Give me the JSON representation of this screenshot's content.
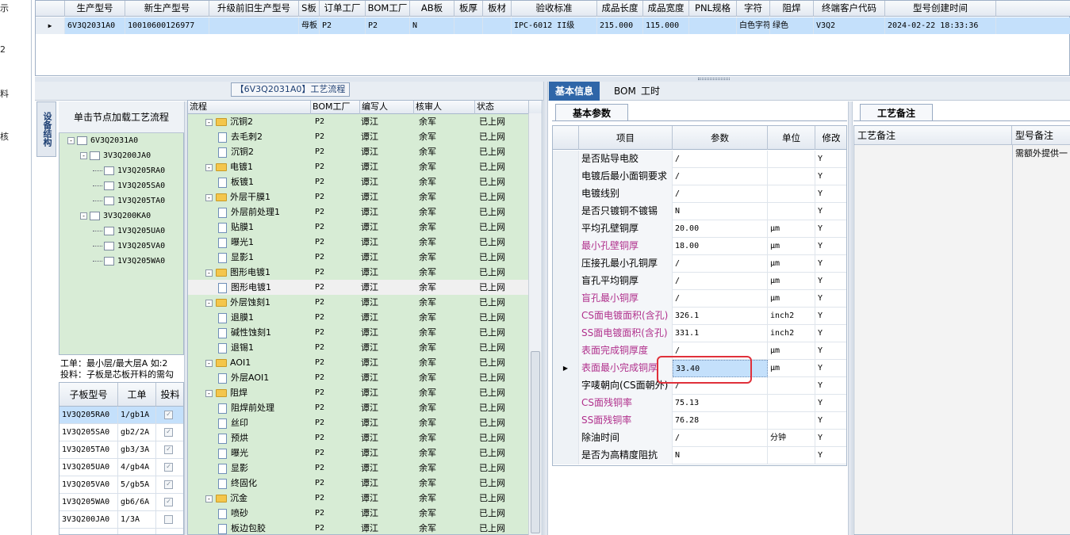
{
  "left_nav": [
    "示",
    "2",
    "料",
    "核"
  ],
  "top_grid": {
    "columns": [
      "生产型号",
      "新生产型号",
      "升级前旧生产型号",
      "S板",
      "订单工厂",
      "BOM工厂",
      "AB板",
      "板厚",
      "板材",
      "验收标准",
      "成品长度",
      "成品宽度",
      "PNL规格",
      "字符",
      "阻焊",
      "终端客户代码",
      "型号创建时间"
    ],
    "row": [
      "6V3Q2031A0",
      "10010600126977",
      "",
      "母板",
      "P2",
      "P2",
      "N",
      "",
      "",
      "IPC-6012 II级",
      "215.000",
      "115.000",
      "",
      "白色字符",
      "绿色",
      "V3Q2",
      "2024-02-22 18:33:36"
    ]
  },
  "lower_title": "【6V3Q2031A0】工艺流程",
  "vtab_label": "设备结构",
  "load_button": "单击节点加载工艺流程",
  "tree": [
    {
      "label": "6V3Q2031A0",
      "level": 0,
      "exp": "-"
    },
    {
      "label": "3V3Q200JA0",
      "level": 1,
      "exp": "-"
    },
    {
      "label": "1V3Q205RA0",
      "level": 2,
      "exp": ""
    },
    {
      "label": "1V3Q205SA0",
      "level": 2,
      "exp": ""
    },
    {
      "label": "1V3Q205TA0",
      "level": 2,
      "exp": ""
    },
    {
      "label": "3V3Q200KA0",
      "level": 1,
      "exp": "-"
    },
    {
      "label": "1V3Q205UA0",
      "level": 2,
      "exp": ""
    },
    {
      "label": "1V3Q205VA0",
      "level": 2,
      "exp": ""
    },
    {
      "label": "1V3Q205WA0",
      "level": 2,
      "exp": ""
    }
  ],
  "info_lines": [
    "工单：最小层/最大层A 如:2",
    "投料：子板是芯板开料的需勾"
  ],
  "sub_grid": {
    "columns": [
      "子板型号",
      "工单",
      "投料"
    ],
    "rows": [
      [
        "1V3Q205RA0",
        "1/gb1A",
        "✓"
      ],
      [
        "1V3Q205SA0",
        "gb2/2A",
        "✓"
      ],
      [
        "1V3Q205TA0",
        "gb3/3A",
        "✓"
      ],
      [
        "1V3Q205UA0",
        "4/gb4A",
        "✓"
      ],
      [
        "1V3Q205VA0",
        "5/gb5A",
        "✓"
      ],
      [
        "1V3Q205WA0",
        "gb6/6A",
        "✓"
      ],
      [
        "3V3Q200JA0",
        "1/3A",
        ""
      ],
      [
        "",
        "",
        ""
      ]
    ]
  },
  "process_grid": {
    "columns": [
      "流程",
      "BOM工厂",
      "编写人",
      "核审人",
      "状态"
    ],
    "rows": [
      {
        "name": "沉铜2",
        "type": "folder",
        "bom": "P2",
        "writer": "谭江",
        "reviewer": "余军",
        "status": "已上网"
      },
      {
        "name": "去毛刺2",
        "type": "doc",
        "bom": "P2",
        "writer": "谭江",
        "reviewer": "余军",
        "status": "已上网"
      },
      {
        "name": "沉铜2",
        "type": "doc",
        "bom": "P2",
        "writer": "谭江",
        "reviewer": "余军",
        "status": "已上网"
      },
      {
        "name": "电镀1",
        "type": "folder",
        "bom": "P2",
        "writer": "谭江",
        "reviewer": "余军",
        "status": "已上网"
      },
      {
        "name": "板镀1",
        "type": "doc",
        "bom": "P2",
        "writer": "谭江",
        "reviewer": "余军",
        "status": "已上网"
      },
      {
        "name": "外层干膜1",
        "type": "folder",
        "bom": "P2",
        "writer": "谭江",
        "reviewer": "余军",
        "status": "已上网"
      },
      {
        "name": "外层前处理1",
        "type": "doc",
        "bom": "P2",
        "writer": "谭江",
        "reviewer": "余军",
        "status": "已上网"
      },
      {
        "name": "贴膜1",
        "type": "doc",
        "bom": "P2",
        "writer": "谭江",
        "reviewer": "余军",
        "status": "已上网"
      },
      {
        "name": "曝光1",
        "type": "doc",
        "bom": "P2",
        "writer": "谭江",
        "reviewer": "余军",
        "status": "已上网"
      },
      {
        "name": "显影1",
        "type": "doc",
        "bom": "P2",
        "writer": "谭江",
        "reviewer": "余军",
        "status": "已上网"
      },
      {
        "name": "图形电镀1",
        "type": "folder",
        "bom": "P2",
        "writer": "谭江",
        "reviewer": "余军",
        "status": "已上网"
      },
      {
        "name": "图形电镀1",
        "type": "doc",
        "bom": "P2",
        "writer": "谭江",
        "reviewer": "余军",
        "status": "已上网",
        "selected": true
      },
      {
        "name": "外层蚀刻1",
        "type": "folder",
        "bom": "P2",
        "writer": "谭江",
        "reviewer": "余军",
        "status": "已上网"
      },
      {
        "name": "退膜1",
        "type": "doc",
        "bom": "P2",
        "writer": "谭江",
        "reviewer": "余军",
        "status": "已上网"
      },
      {
        "name": "碱性蚀刻1",
        "type": "doc",
        "bom": "P2",
        "writer": "谭江",
        "reviewer": "余军",
        "status": "已上网"
      },
      {
        "name": "退锡1",
        "type": "doc",
        "bom": "P2",
        "writer": "谭江",
        "reviewer": "余军",
        "status": "已上网"
      },
      {
        "name": "AOI1",
        "type": "folder",
        "bom": "P2",
        "writer": "谭江",
        "reviewer": "余军",
        "status": "已上网"
      },
      {
        "name": "外层AOI1",
        "type": "doc",
        "bom": "P2",
        "writer": "谭江",
        "reviewer": "余军",
        "status": "已上网"
      },
      {
        "name": "阻焊",
        "type": "folder",
        "bom": "P2",
        "writer": "谭江",
        "reviewer": "余军",
        "status": "已上网"
      },
      {
        "name": "阻焊前处理",
        "type": "doc",
        "bom": "P2",
        "writer": "谭江",
        "reviewer": "余军",
        "status": "已上网"
      },
      {
        "name": "丝印",
        "type": "doc",
        "bom": "P2",
        "writer": "谭江",
        "reviewer": "余军",
        "status": "已上网"
      },
      {
        "name": "预烘",
        "type": "doc",
        "bom": "P2",
        "writer": "谭江",
        "reviewer": "余军",
        "status": "已上网"
      },
      {
        "name": "曝光",
        "type": "doc",
        "bom": "P2",
        "writer": "谭江",
        "reviewer": "余军",
        "status": "已上网"
      },
      {
        "name": "显影",
        "type": "doc",
        "bom": "P2",
        "writer": "谭江",
        "reviewer": "余军",
        "status": "已上网"
      },
      {
        "name": "终固化",
        "type": "doc",
        "bom": "P2",
        "writer": "谭江",
        "reviewer": "余军",
        "status": "已上网"
      },
      {
        "name": "沉金",
        "type": "folder",
        "bom": "P2",
        "writer": "谭江",
        "reviewer": "余军",
        "status": "已上网"
      },
      {
        "name": "喷砂",
        "type": "doc",
        "bom": "P2",
        "writer": "谭江",
        "reviewer": "余军",
        "status": "已上网"
      },
      {
        "name": "板边包胶",
        "type": "doc",
        "bom": "P2",
        "writer": "谭江",
        "reviewer": "余军",
        "status": "已上网"
      }
    ]
  },
  "right_tabs": [
    "基本信息",
    "BOM",
    "工时"
  ],
  "basic_param_tab": "基本参数",
  "process_note_tab": "工艺备注",
  "param_grid": {
    "columns": [
      "项目",
      "参数",
      "单位",
      "修改"
    ],
    "rows": [
      {
        "item": "是否贴导电胶",
        "value": "/",
        "unit": "",
        "mod": "Y",
        "pink": false
      },
      {
        "item": "电镀后最小面铜要求",
        "value": "/",
        "unit": "",
        "mod": "Y",
        "pink": false
      },
      {
        "item": "电镀线别",
        "value": "/",
        "unit": "",
        "mod": "Y",
        "pink": false
      },
      {
        "item": "是否只镀铜不镀锡",
        "value": "N",
        "unit": "",
        "mod": "Y",
        "pink": false
      },
      {
        "item": "平均孔壁铜厚",
        "value": "20.00",
        "unit": "μm",
        "mod": "Y",
        "pink": false
      },
      {
        "item": "最小孔壁铜厚",
        "value": "18.00",
        "unit": "μm",
        "mod": "Y",
        "pink": true
      },
      {
        "item": "压接孔最小孔铜厚",
        "value": "/",
        "unit": "μm",
        "mod": "Y",
        "pink": false
      },
      {
        "item": "盲孔平均铜厚",
        "value": "/",
        "unit": "μm",
        "mod": "Y",
        "pink": false
      },
      {
        "item": "盲孔最小铜厚",
        "value": "/",
        "unit": "μm",
        "mod": "Y",
        "pink": true
      },
      {
        "item": "CS面电镀面积(含孔)",
        "value": "326.1",
        "unit": "inch2",
        "mod": "Y",
        "pink": true
      },
      {
        "item": "SS面电镀面积(含孔)",
        "value": "331.1",
        "unit": "inch2",
        "mod": "Y",
        "pink": true
      },
      {
        "item": "表面完成铜厚度",
        "value": "/",
        "unit": "μm",
        "mod": "Y",
        "pink": true
      },
      {
        "item": "表面最小完成铜厚",
        "value": "33.40",
        "unit": "μm",
        "mod": "Y",
        "pink": true,
        "current": true
      },
      {
        "item": "字唛朝向(CS面朝外)",
        "value": "/",
        "unit": "",
        "mod": "Y",
        "pink": false
      },
      {
        "item": "CS面残铜率",
        "value": "75.13",
        "unit": "",
        "mod": "Y",
        "pink": true
      },
      {
        "item": "SS面残铜率",
        "value": "76.28",
        "unit": "",
        "mod": "Y",
        "pink": true
      },
      {
        "item": "除油时间",
        "value": "/",
        "unit": "分钟",
        "mod": "Y",
        "pink": false
      },
      {
        "item": "是否为高精度阻抗",
        "value": "N",
        "unit": "",
        "mod": "Y",
        "pink": false
      }
    ]
  },
  "note_panel": {
    "columns": [
      "工艺备注",
      "型号备注"
    ],
    "model_note": "需额外提供一"
  },
  "colors": {
    "accent": "#2f66a8",
    "selection": "#c4e0fb",
    "tree_bg": "#d7ecd5",
    "pink_text": "#b0308c",
    "highlight": "#e0303a"
  }
}
